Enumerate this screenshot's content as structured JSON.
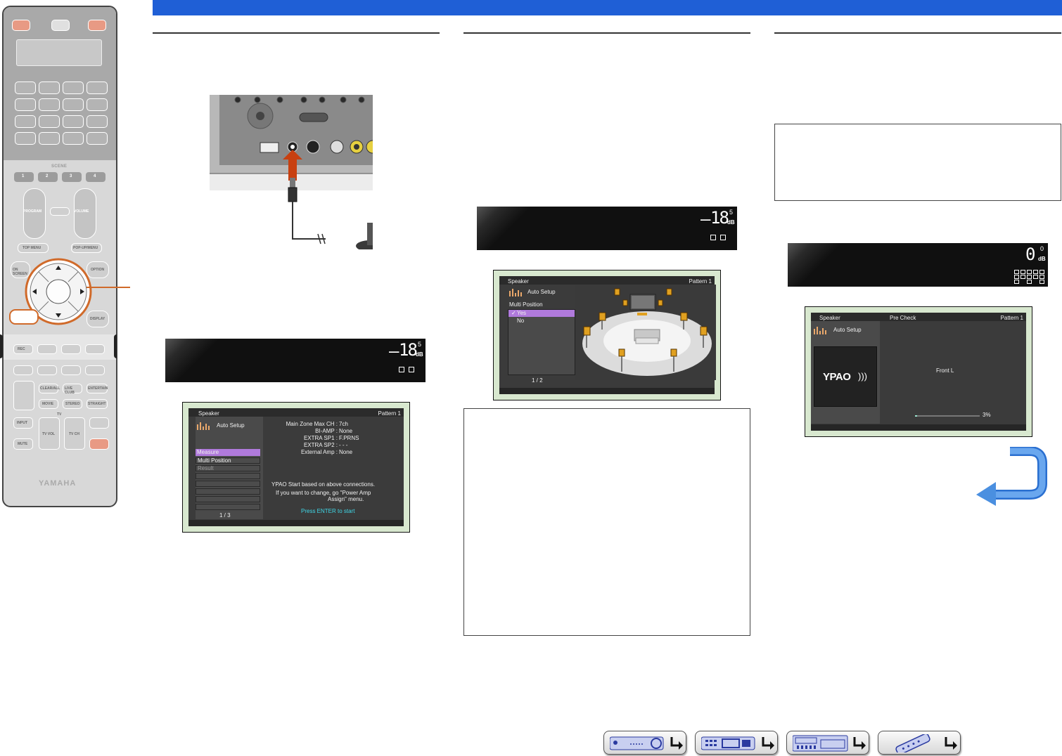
{
  "colors": {
    "header_bar": "#1f5fd6",
    "highlight_ring": "#d06a2a",
    "menu_highlight": "#b07adc",
    "cyan_prompt": "#3fd8e8",
    "return_arrow": "#4a8fe0"
  },
  "remote": {
    "scene_label": "SCENE",
    "scene_buttons": [
      "1",
      "2",
      "3",
      "4"
    ],
    "program_label": "PROGRAM",
    "volume_label": "VOLUME",
    "top_menu": "TOP MENU",
    "popup_menu": "POP-UP/MENU",
    "on_screen": "ON SCREEN",
    "option": "OPTION",
    "display": "DISPLAY",
    "rec": "REC",
    "tv_label": "TV",
    "row_labels_a": [
      "CLEAR/ALL",
      "LIVE CLUB",
      "ENTERTAIN"
    ],
    "row_labels_b": [
      "MOVIE",
      "STEREO",
      "STRAIGHT"
    ],
    "input": "INPUT",
    "mute": "MUTE",
    "tv_vol": "TV VOL",
    "tv_ch": "TV CH",
    "brand": "YAMAHA"
  },
  "displays": {
    "d1": {
      "sign": "–",
      "digits": "18",
      "decimal": "5",
      "unit": "dB"
    },
    "d2": {
      "sign": "–",
      "digits": "18",
      "decimal": "5",
      "unit": "dB"
    },
    "d3": {
      "sign": "",
      "digits": "0",
      "decimal": "0",
      "unit": "dB"
    }
  },
  "osd1": {
    "title": "Speaker",
    "pattern": "Pattern 1",
    "auto_setup": "Auto Setup",
    "menu_items": [
      "Measure",
      "Multi Position",
      "Result"
    ],
    "page": "1 / 3",
    "info_labels": [
      "Main Zone Max CH :",
      "BI-AMP :",
      "EXTRA SP1 :",
      "EXTRA SP2 :",
      "External Amp :"
    ],
    "info_values": [
      "7ch",
      "None",
      "F.PRNS",
      "- - -",
      "None"
    ],
    "msg1": "YPAO Start based on above connections.",
    "msg2": "If you want to change, go \"Power Amp",
    "msg3": "Assign\" menu.",
    "prompt": "Press ENTER to start"
  },
  "osd2": {
    "title": "Speaker",
    "pattern": "Pattern 1",
    "auto_setup": "Auto Setup",
    "section": "Multi Position",
    "options": [
      "Yes",
      "No"
    ],
    "page": "1 / 2"
  },
  "osd3": {
    "title": "Speaker",
    "subtitle": "Pre Check",
    "pattern": "Pattern 1",
    "auto_setup": "Auto Setup",
    "logo": "YPAO",
    "channel": "Front L",
    "progress_percent": 3,
    "progress_label": "3%"
  }
}
